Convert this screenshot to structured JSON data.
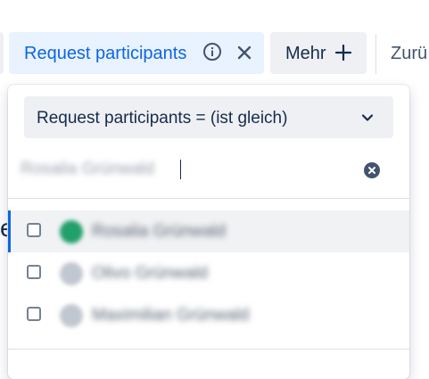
{
  "filter_bar": {
    "active_filter_label": "Request participants",
    "more_label": "Mehr",
    "back_label": "Zurü"
  },
  "dropdown": {
    "operator_select": "Request participants = (ist gleich)",
    "search_value": "Rosalia Grünwald",
    "options": [
      {
        "name": "Rosalia Grünwald",
        "checked": false,
        "highlighted": true
      },
      {
        "name": "Olivo Grünwald",
        "checked": false,
        "highlighted": false
      },
      {
        "name": "Maximilian Grünwald",
        "checked": false,
        "highlighted": false
      }
    ]
  },
  "background_text": "e",
  "colors": {
    "accent": "#0c66e4",
    "chip_active_bg": "#e9f2ff",
    "chip_bg": "#eef0f3",
    "avatar_green": "#22a06b",
    "avatar_gray": "#c1c7d0"
  }
}
